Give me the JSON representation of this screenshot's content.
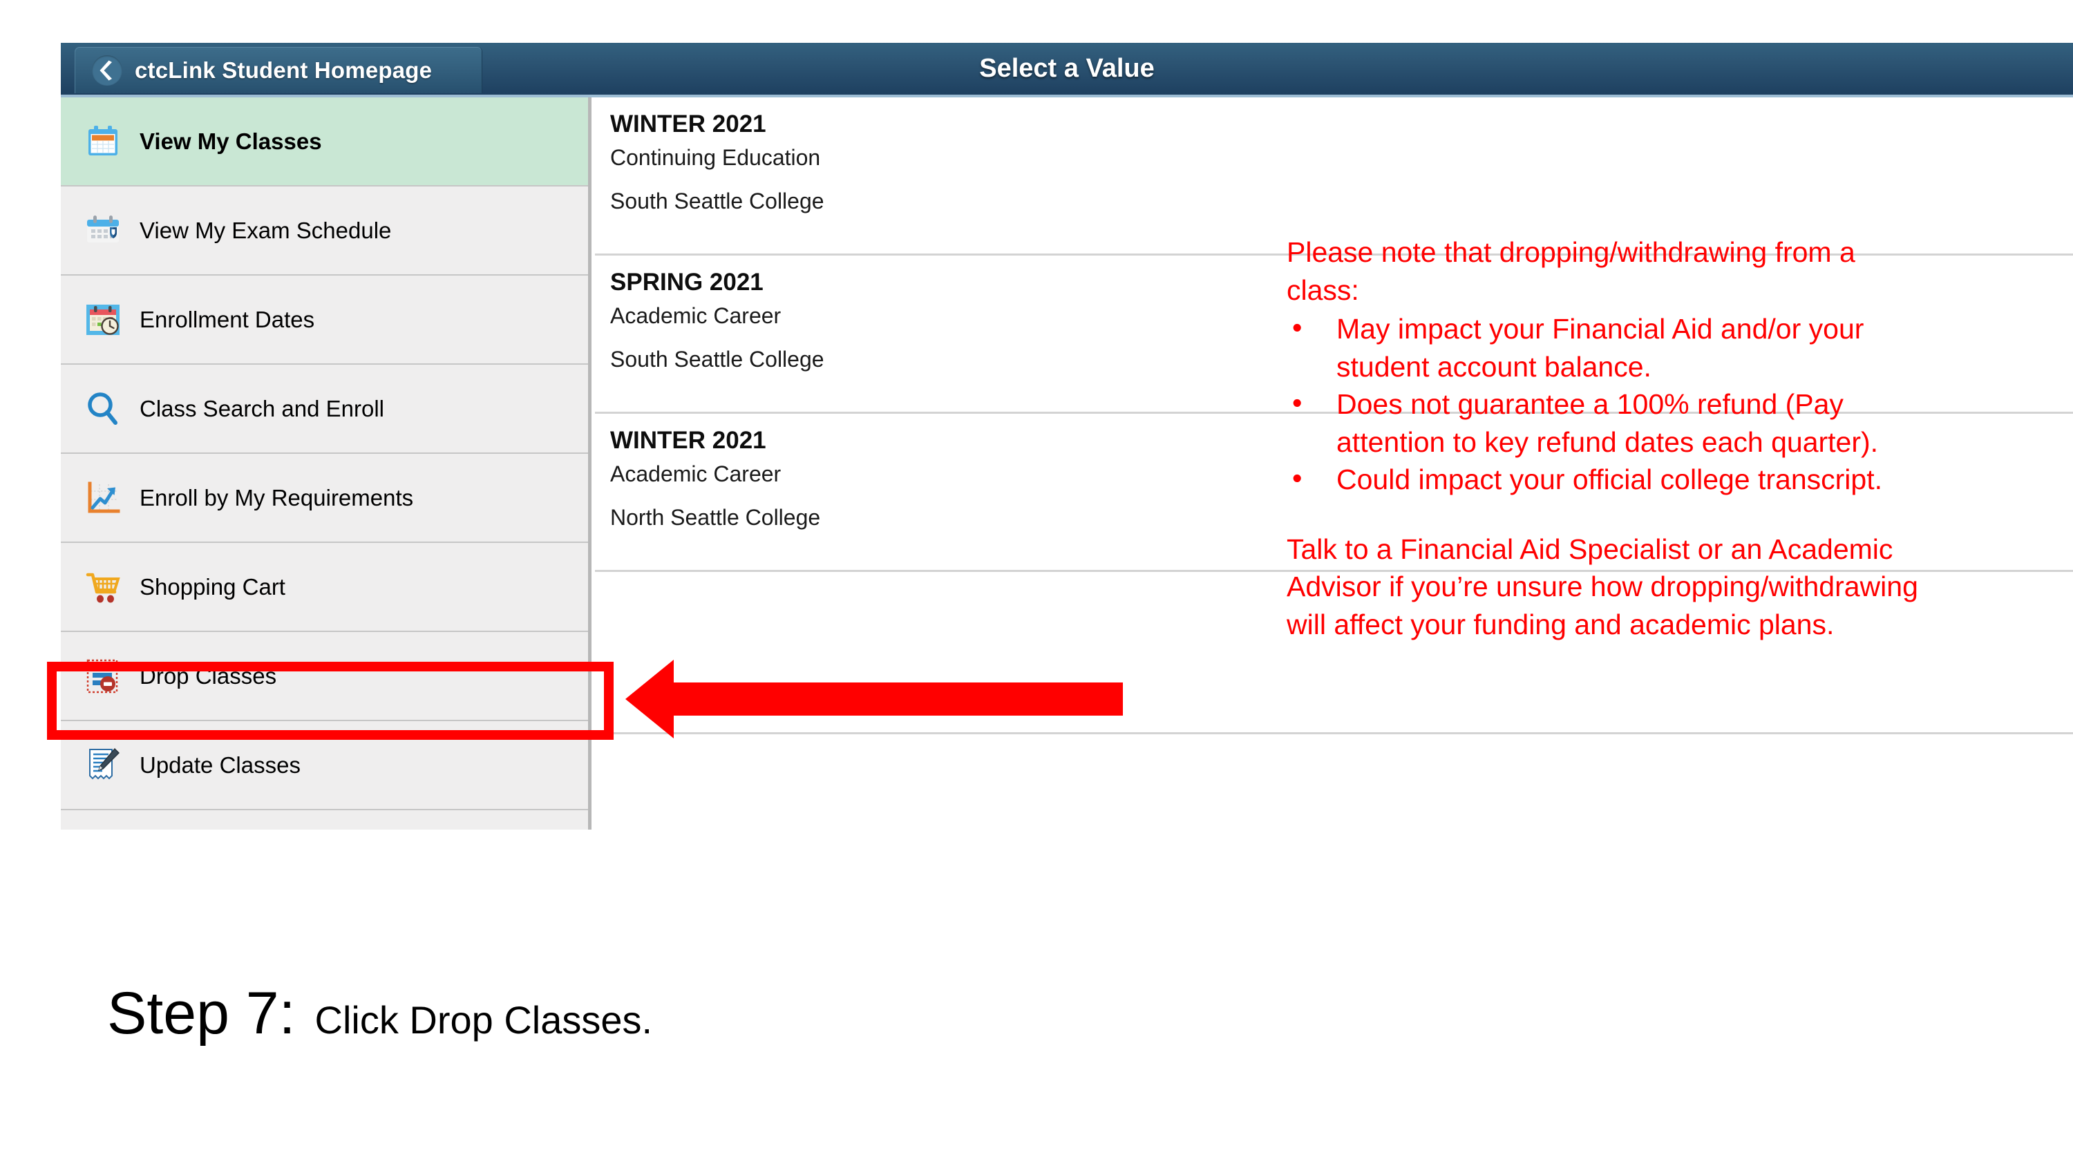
{
  "header": {
    "back_button_label": "ctcLink Student Homepage",
    "back_icon": "chevron-left-icon",
    "title": "Select a Value"
  },
  "sidebar": {
    "items": [
      {
        "label": "View My Classes",
        "icon": "calendar-icon",
        "selected": true
      },
      {
        "label": "View My Exam Schedule",
        "icon": "calendar-shield-icon",
        "selected": false
      },
      {
        "label": "Enrollment Dates",
        "icon": "calendar-clock-icon",
        "selected": false
      },
      {
        "label": "Class Search and Enroll",
        "icon": "magnifier-icon",
        "selected": false
      },
      {
        "label": "Enroll by My Requirements",
        "icon": "line-chart-icon",
        "selected": false
      },
      {
        "label": "Shopping Cart",
        "icon": "shopping-cart-icon",
        "selected": false
      },
      {
        "label": "Drop Classes",
        "icon": "drop-classes-icon",
        "selected": false
      },
      {
        "label": "Update Classes",
        "icon": "document-pencil-icon",
        "selected": false
      }
    ]
  },
  "main": {
    "terms": [
      {
        "term": "WINTER 2021",
        "career": "Continuing Education",
        "college": "South Seattle College"
      },
      {
        "term": "SPRING 2021",
        "career": "Academic Career",
        "college": "South Seattle College"
      },
      {
        "term": "WINTER 2021",
        "career": "Academic Career",
        "college": "North Seattle College"
      }
    ]
  },
  "annotations": {
    "highlight_target": "Drop Classes",
    "arrow_points_to": "Drop Classes",
    "accent_color": "#ff0000",
    "note": {
      "intro": "Please note that dropping/withdrawing from a class:",
      "bullet_char": "•",
      "bullets": [
        "May impact your Financial Aid and/or your student account balance.",
        "Does not guarantee a 100% refund (Pay attention to key refund dates each quarter).",
        "Could impact your official college transcript."
      ],
      "tail": "Talk to a Financial Aid Specialist or an Academic Advisor if you’re unsure how dropping/withdrawing will affect your funding and academic plans."
    },
    "caption": {
      "step": "Step 7:",
      "text": "Click Drop Classes."
    }
  },
  "colors": {
    "header_blue": "#2c5473",
    "selected_green": "#c9e7d4",
    "sidebar_gray": "#efeeee",
    "annotation_red": "#ff0000"
  }
}
